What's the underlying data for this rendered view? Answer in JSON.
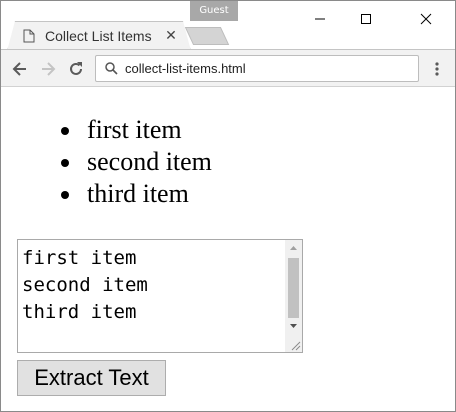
{
  "window": {
    "profile_badge": "Guest"
  },
  "tab": {
    "title": "Collect List Items",
    "close_label": "✕"
  },
  "toolbar": {
    "url": "collect-list-items.html"
  },
  "list": {
    "items": [
      "first item",
      "second item",
      "third item"
    ]
  },
  "output": {
    "text": "first item\nsecond item\nthird item"
  },
  "extract_button": {
    "label": "Extract Text"
  },
  "icons": {
    "favicon": "page-icon",
    "back": "arrow-left-icon",
    "forward": "arrow-right-icon",
    "reload": "reload-icon",
    "search": "search-icon",
    "menu": "more-vertical-icon",
    "minimize": "minimize-icon",
    "maximize": "maximize-icon",
    "close": "close-icon"
  }
}
